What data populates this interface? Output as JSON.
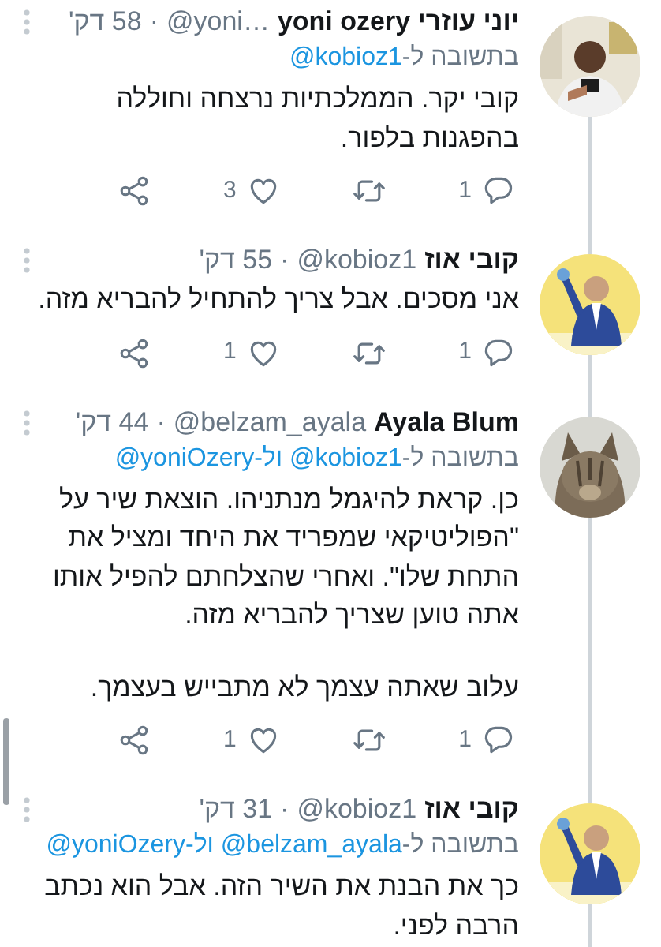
{
  "tweets": [
    {
      "avatar": {
        "kind": "picture"
      },
      "name": "יוני עוזרי yoni ozery",
      "handle": "@yoni…",
      "separator": "·",
      "time": "58 דק'",
      "reply": {
        "prefix": "בתשובה ל-",
        "mentions": [
          "@kobioz1"
        ]
      },
      "paragraphs": [
        "קובי יקר. הממלכתיות נרצחה וחוללה בהפגנות בלפור."
      ],
      "actions": {
        "replies": "1",
        "likes": "3"
      }
    },
    {
      "avatar": {
        "kind": "picture"
      },
      "name": "קובי אוז",
      "handle": "@kobioz1",
      "separator": "·",
      "time": "55 דק'",
      "paragraphs": [
        "אני מסכים. אבל צריך להתחיל להבריא מזה."
      ],
      "actions": {
        "replies": "1",
        "likes": "1"
      }
    },
    {
      "avatar": {
        "kind": "picture"
      },
      "name": "Ayala Blum",
      "handle": "@belzam_ayala",
      "separator": "·",
      "time": "44 דק'",
      "reply": {
        "prefix": "בתשובה ל-",
        "mentions": [
          "@kobioz1",
          "@yoniOzery"
        ],
        "joiner": "ול-"
      },
      "paragraphs": [
        "כן. קראת להיגמל מנתניהו. הוצאת שיר על \"הפוליטיקאי שמפריד את היחד ומציל את התחת שלו\". ואחרי שהצלחתם להפיל אותו אתה טוען שצריך להבריא מזה.",
        "עלוב שאתה עצמך לא מתבייש בעצמך."
      ],
      "actions": {
        "replies": "1",
        "likes": "1"
      }
    },
    {
      "avatar": {
        "kind": "picture"
      },
      "name": "קובי אוז",
      "handle": "@kobioz1",
      "separator": "·",
      "time": "31 דק'",
      "reply": {
        "prefix": "בתשובה ל-",
        "mentions": [
          "@belzam_ayala",
          "@yoniOzery"
        ],
        "joiner": "ול-"
      },
      "paragraphs": [
        "כך את הבנת את השיר הזה. אבל הוא נכתב הרבה לפני."
      ]
    }
  ]
}
